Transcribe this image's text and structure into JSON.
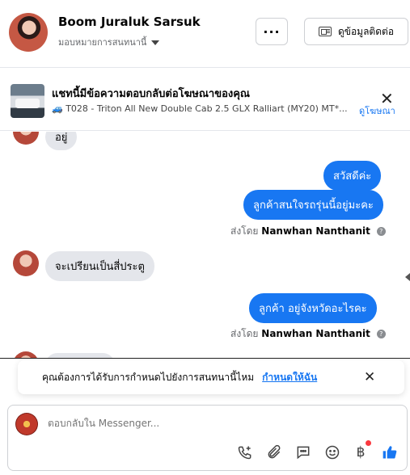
{
  "header": {
    "name": "Boom Juraluk Sarsuk",
    "assign_label": "มอบหมายการสนทนานี้",
    "more_label": "···",
    "contact_button": "ดูข้อมูลติดต่อ"
  },
  "ad_banner": {
    "title": "แชทนี้มีข้อความตอบกลับต่อโฆษณาของคุณ",
    "subtitle": "🚙 T028 - Triton All New Double Cab 2.5 GLX Ralliart (MY20) MT*...",
    "view_ad_label": "ดูโฆษณา",
    "close": "✕"
  },
  "messages": [
    {
      "from": "customer",
      "text": "อยู่"
    },
    {
      "from": "page",
      "text": "สวัสดีค่ะ"
    },
    {
      "from": "page",
      "text": "ลูกค้าสนใจรถรุ่นนี้อยู่มะคะ"
    },
    {
      "from": "customer",
      "text": "จะเปรียนเป็นสี่ประตู"
    },
    {
      "from": "page",
      "text": "ลูกค้า  อยู่จังหวัดอะไรคะ"
    }
  ],
  "sent_by_prefix": "ส่งโดย",
  "sent_by_name": "Nanwhan Nanthanit",
  "assign_prompt": {
    "text": "คุณต้องการได้รับการกำหนดไปยังการสนทนานี้ไหม",
    "action": "กำหนดให้ฉัน",
    "close": "✕"
  },
  "composer": {
    "placeholder": "ตอบกลับใน Messenger..."
  },
  "colors": {
    "accent": "#1877f2",
    "incoming_bubble": "#e4e6eb",
    "notification_dot": "#fa383e"
  }
}
